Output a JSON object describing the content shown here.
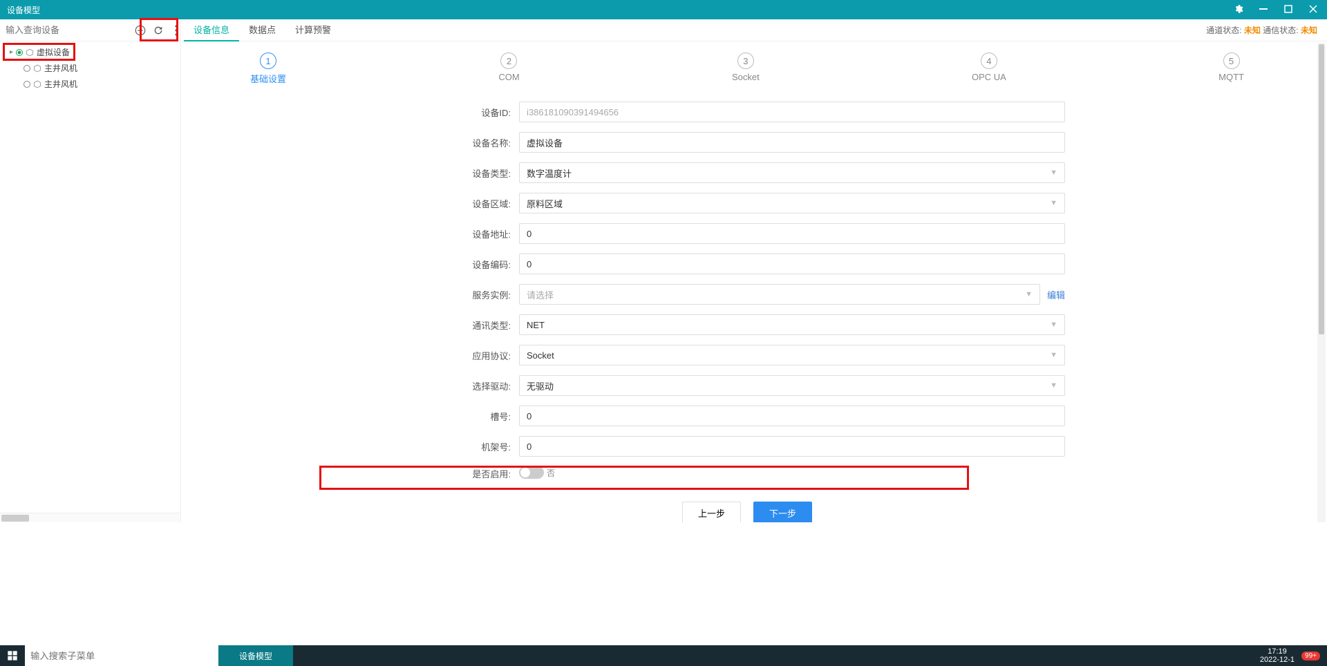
{
  "window": {
    "title": "设备模型"
  },
  "sidebar": {
    "search_placeholder": "输入查询设备",
    "nodes": [
      {
        "label": "虚拟设备",
        "level": 1,
        "active": true
      },
      {
        "label": "主井风机",
        "level": 2,
        "active": false
      },
      {
        "label": "主井风机",
        "level": 2,
        "active": false
      }
    ]
  },
  "tabs": {
    "items": [
      {
        "label": "设备信息",
        "active": true
      },
      {
        "label": "数据点",
        "active": false
      },
      {
        "label": "计算预警",
        "active": false
      }
    ]
  },
  "status": {
    "channel_label": "通道状态:",
    "channel_value": "未知",
    "comm_label": "通信状态:",
    "comm_value": "未知"
  },
  "steps": [
    {
      "num": "1",
      "label": "基础设置",
      "active": true
    },
    {
      "num": "2",
      "label": "COM",
      "active": false
    },
    {
      "num": "3",
      "label": "Socket",
      "active": false
    },
    {
      "num": "4",
      "label": "OPC UA",
      "active": false
    },
    {
      "num": "5",
      "label": "MQTT",
      "active": false
    }
  ],
  "form": {
    "device_id": {
      "label": "设备ID:",
      "value": "i386181090391494656"
    },
    "device_name": {
      "label": "设备名称:",
      "value": "虚拟设备"
    },
    "device_type": {
      "label": "设备类型:",
      "value": "数字温度计"
    },
    "device_area": {
      "label": "设备区域:",
      "value": "原料区域"
    },
    "device_addr": {
      "label": "设备地址:",
      "value": "0"
    },
    "device_code": {
      "label": "设备编码:",
      "value": "0"
    },
    "service_instance": {
      "label": "服务实例:",
      "placeholder": "请选择",
      "edit": "编辑"
    },
    "comm_type": {
      "label": "通讯类型:",
      "value": "NET"
    },
    "app_protocol": {
      "label": "应用协议:",
      "value": "Socket"
    },
    "driver": {
      "label": "选择驱动:",
      "value": "无驱动"
    },
    "slot": {
      "label": "槽号:",
      "value": "0"
    },
    "rack": {
      "label": "机架号:",
      "value": "0"
    },
    "enable": {
      "label": "是否启用:",
      "value": "否"
    }
  },
  "buttons": {
    "prev": "上一步",
    "next": "下一步"
  },
  "taskbar": {
    "search_placeholder": "输入搜索子菜单",
    "active_app": "设备模型",
    "time": "17:19",
    "date": "2022-12-1",
    "badge": "99+"
  }
}
